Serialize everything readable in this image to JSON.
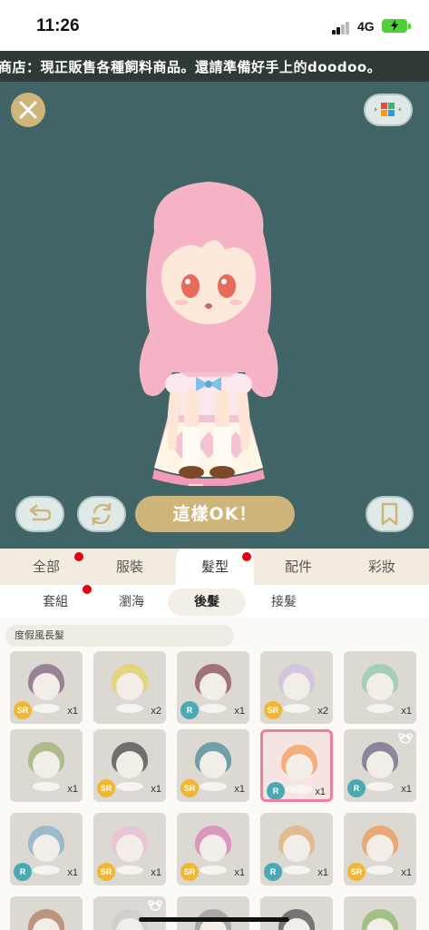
{
  "status": {
    "time": "11:26",
    "network": "4G"
  },
  "marquee": {
    "text": "商店：現正販售各種飼料商品。還請準備好手上的doodoo。"
  },
  "stage": {
    "background": "#416467",
    "ok_label": "這樣OK！"
  },
  "tabs": [
    {
      "label": "全部",
      "dot": true
    },
    {
      "label": "服裝",
      "dot": false
    },
    {
      "label": "髮型",
      "dot": true,
      "active": true
    },
    {
      "label": "配件",
      "dot": false
    },
    {
      "label": "彩妝",
      "dot": false
    }
  ],
  "subtabs": [
    {
      "label": "套組",
      "dot": true
    },
    {
      "label": "瀏海",
      "dot": false
    },
    {
      "label": "後髮",
      "active": true
    },
    {
      "label": "接髮",
      "dot": false
    }
  ],
  "section_label": "度假風長髮",
  "items": [
    {
      "rarity": "SR",
      "count": "x1",
      "hair": "#6b4a6e"
    },
    {
      "rarity": "",
      "count": "x2",
      "hair": "#e8d24a"
    },
    {
      "rarity": "R",
      "count": "x1",
      "hair": "#7a2d3d"
    },
    {
      "rarity": "SR",
      "count": "x2",
      "hair": "#cdb9e6"
    },
    {
      "rarity": "",
      "count": "x1",
      "hair": "#7fc8a9"
    },
    {
      "rarity": "",
      "count": "x1",
      "hair": "#8fa85e"
    },
    {
      "rarity": "SR",
      "count": "x1",
      "hair": "#2a2a2a"
    },
    {
      "rarity": "SR",
      "count": "x1",
      "hair": "#2a7a8a"
    },
    {
      "rarity": "R",
      "count": "x1",
      "hair": "#f28a3a",
      "selected": true
    },
    {
      "rarity": "R",
      "count": "x1",
      "hair": "#5a4e78",
      "bear": true
    },
    {
      "rarity": "R",
      "count": "x1",
      "hair": "#6fa8c8"
    },
    {
      "rarity": "SR",
      "count": "x1",
      "hair": "#f0b8d8"
    },
    {
      "rarity": "SR",
      "count": "x1",
      "hair": "#d86ab0"
    },
    {
      "rarity": "R",
      "count": "x1",
      "hair": "#e6a868"
    },
    {
      "rarity": "SR",
      "count": "x1",
      "hair": "#f28a3a"
    },
    {
      "rarity": "",
      "count": "",
      "hair": "#a8684a"
    },
    {
      "rarity": "",
      "count": "",
      "hair": "#cccccc",
      "bear": true
    },
    {
      "rarity": "",
      "count": "",
      "hair": "#8a8a8a"
    },
    {
      "rarity": "",
      "count": "",
      "hair": "#333333"
    },
    {
      "rarity": "",
      "count": "",
      "hair": "#7ab050"
    }
  ]
}
